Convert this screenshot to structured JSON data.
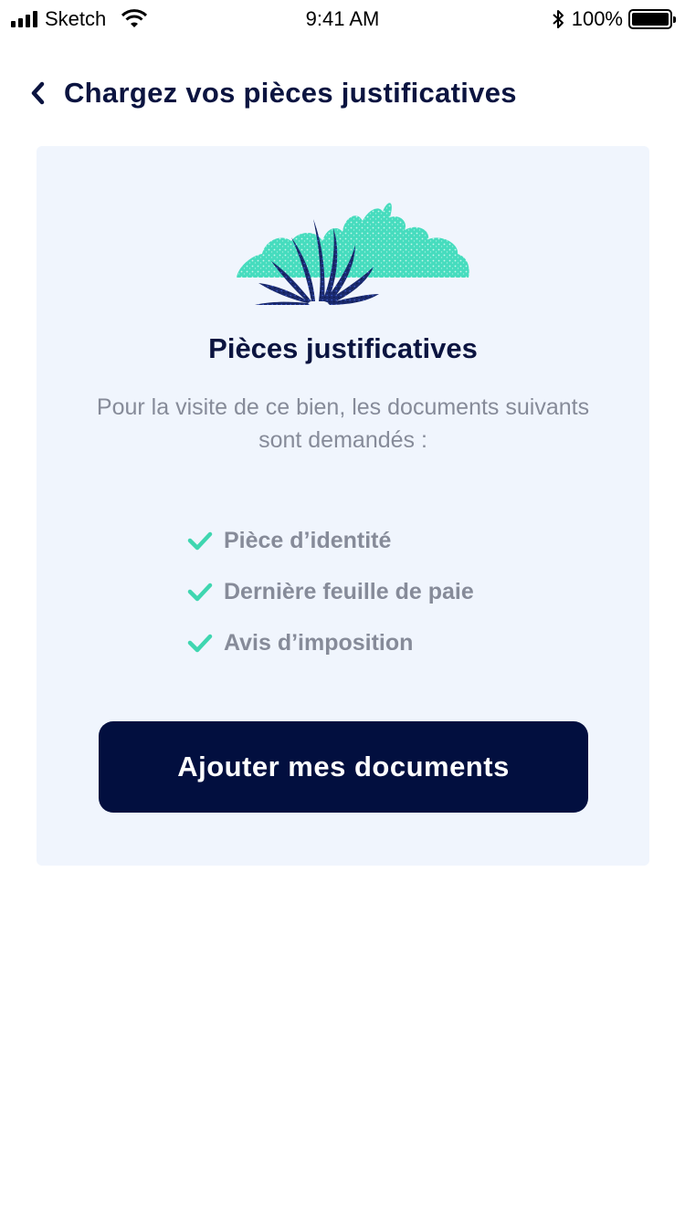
{
  "status_bar": {
    "carrier": "Sketch",
    "time": "9:41 AM",
    "battery_percent": "100%",
    "icons": [
      "signal-icon",
      "wifi-icon",
      "bluetooth-icon",
      "battery-icon"
    ]
  },
  "header": {
    "back_icon": "chevron-left-icon",
    "title": "Chargez vos pièces justificatives"
  },
  "card": {
    "illustration": "plant-illustration",
    "title": "Pièces justificatives",
    "description": "Pour la visite de ce bien, les documents suivants sont demandés :",
    "documents": [
      {
        "label": "Pièce d’identité",
        "icon": "check-icon"
      },
      {
        "label": "Dernière feuille de paie",
        "icon": "check-icon"
      },
      {
        "label": "Avis d’imposition",
        "icon": "check-icon"
      }
    ],
    "button_label": "Ajouter mes documents"
  },
  "colors": {
    "navy": "#0b1440",
    "button": "#020f3f",
    "card_background": "#f0f5fd",
    "muted_text": "#868b99",
    "accent_teal": "#3fd6b0"
  }
}
